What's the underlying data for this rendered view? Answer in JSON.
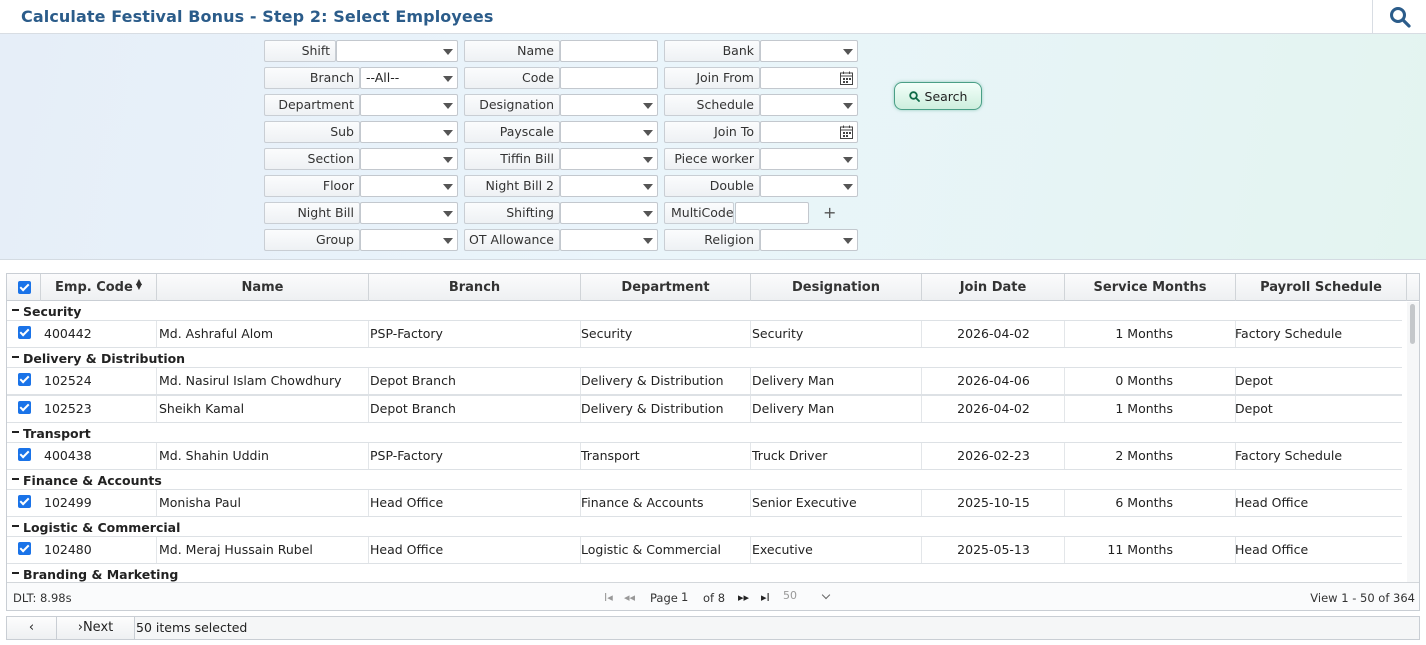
{
  "header": {
    "title": "Calculate Festival Bonus - Step 2: Select Employees"
  },
  "filters": {
    "col1": [
      {
        "label": "Shift",
        "value": ""
      },
      {
        "label": "Branch",
        "value": "--All--"
      },
      {
        "label": "Department",
        "value": ""
      },
      {
        "label": "Sub",
        "value": ""
      },
      {
        "label": "Section",
        "value": ""
      },
      {
        "label": "Floor",
        "value": ""
      },
      {
        "label": "Night Bill",
        "value": ""
      },
      {
        "label": "Group",
        "value": ""
      }
    ],
    "col2": [
      {
        "label": "Name",
        "value": ""
      },
      {
        "label": "Code",
        "value": ""
      },
      {
        "label": "Designation",
        "value": ""
      },
      {
        "label": "Payscale",
        "value": ""
      },
      {
        "label": "Tiffin Bill",
        "value": ""
      },
      {
        "label": "Night Bill 2",
        "value": ""
      },
      {
        "label": "Shifting",
        "value": ""
      },
      {
        "label": "OT Allowance",
        "value": ""
      }
    ],
    "col3": [
      {
        "label": "Bank",
        "value": ""
      },
      {
        "label": "Join From",
        "value": ""
      },
      {
        "label": "Schedule",
        "value": ""
      },
      {
        "label": "Join To",
        "value": ""
      },
      {
        "label": "Piece worker",
        "value": ""
      },
      {
        "label": "Double",
        "value": ""
      },
      {
        "label": "MultiCode",
        "value": ""
      },
      {
        "label": "Religion",
        "value": ""
      }
    ],
    "search_label": "Search"
  },
  "grid": {
    "columns": [
      "Emp. Code",
      "Name",
      "Branch",
      "Department",
      "Designation",
      "Join Date",
      "Service Months",
      "Payroll Schedule"
    ],
    "groups": [
      {
        "name": "Security",
        "rows": [
          {
            "code": "400442",
            "name": "Md. Ashraful Alom",
            "branch": "PSP-Factory",
            "department": "Security",
            "designation": "Security",
            "join_date": "2026-04-02",
            "service": "1 Months",
            "schedule": "Factory Schedule"
          }
        ]
      },
      {
        "name": "Delivery & Distribution",
        "rows": [
          {
            "code": "102524",
            "name": "Md. Nasirul Islam Chowdhury",
            "branch": "Depot Branch",
            "department": "Delivery & Distribution",
            "designation": "Delivery Man",
            "join_date": "2026-04-06",
            "service": "0 Months",
            "schedule": "Depot"
          },
          {
            "code": "102523",
            "name": "Sheikh Kamal",
            "branch": "Depot Branch",
            "department": "Delivery & Distribution",
            "designation": "Delivery Man",
            "join_date": "2026-04-02",
            "service": "1 Months",
            "schedule": "Depot"
          }
        ]
      },
      {
        "name": "Transport",
        "rows": [
          {
            "code": "400438",
            "name": "Md. Shahin Uddin",
            "branch": "PSP-Factory",
            "department": "Transport",
            "designation": "Truck Driver",
            "join_date": "2026-02-23",
            "service": "2 Months",
            "schedule": "Factory Schedule"
          }
        ]
      },
      {
        "name": "Finance & Accounts",
        "rows": [
          {
            "code": "102499",
            "name": "Monisha Paul",
            "branch": "Head Office",
            "department": "Finance & Accounts",
            "designation": "Senior Executive",
            "join_date": "2025-10-15",
            "service": "6 Months",
            "schedule": "Head Office"
          }
        ]
      },
      {
        "name": "Logistic & Commercial",
        "rows": [
          {
            "code": "102480",
            "name": "Md. Meraj Hussain Rubel",
            "branch": "Head Office",
            "department": "Logistic & Commercial",
            "designation": "Executive",
            "join_date": "2025-05-13",
            "service": "11 Months",
            "schedule": "Head Office"
          }
        ]
      },
      {
        "name": "Branding & Marketing",
        "rows": []
      }
    ]
  },
  "pager": {
    "dlt": "DLT: 8.98s",
    "page_label": "Page",
    "page": "1",
    "of_label": "of 8",
    "page_size": "50",
    "view": "View 1 - 50 of 364"
  },
  "footer": {
    "prev_label": "‹",
    "next_label": "Next",
    "selected": "50 items selected"
  },
  "colors": {
    "title": "#2b5c8a",
    "checkbox": "#1a73e8",
    "search_button_border": "#4a9f86"
  }
}
